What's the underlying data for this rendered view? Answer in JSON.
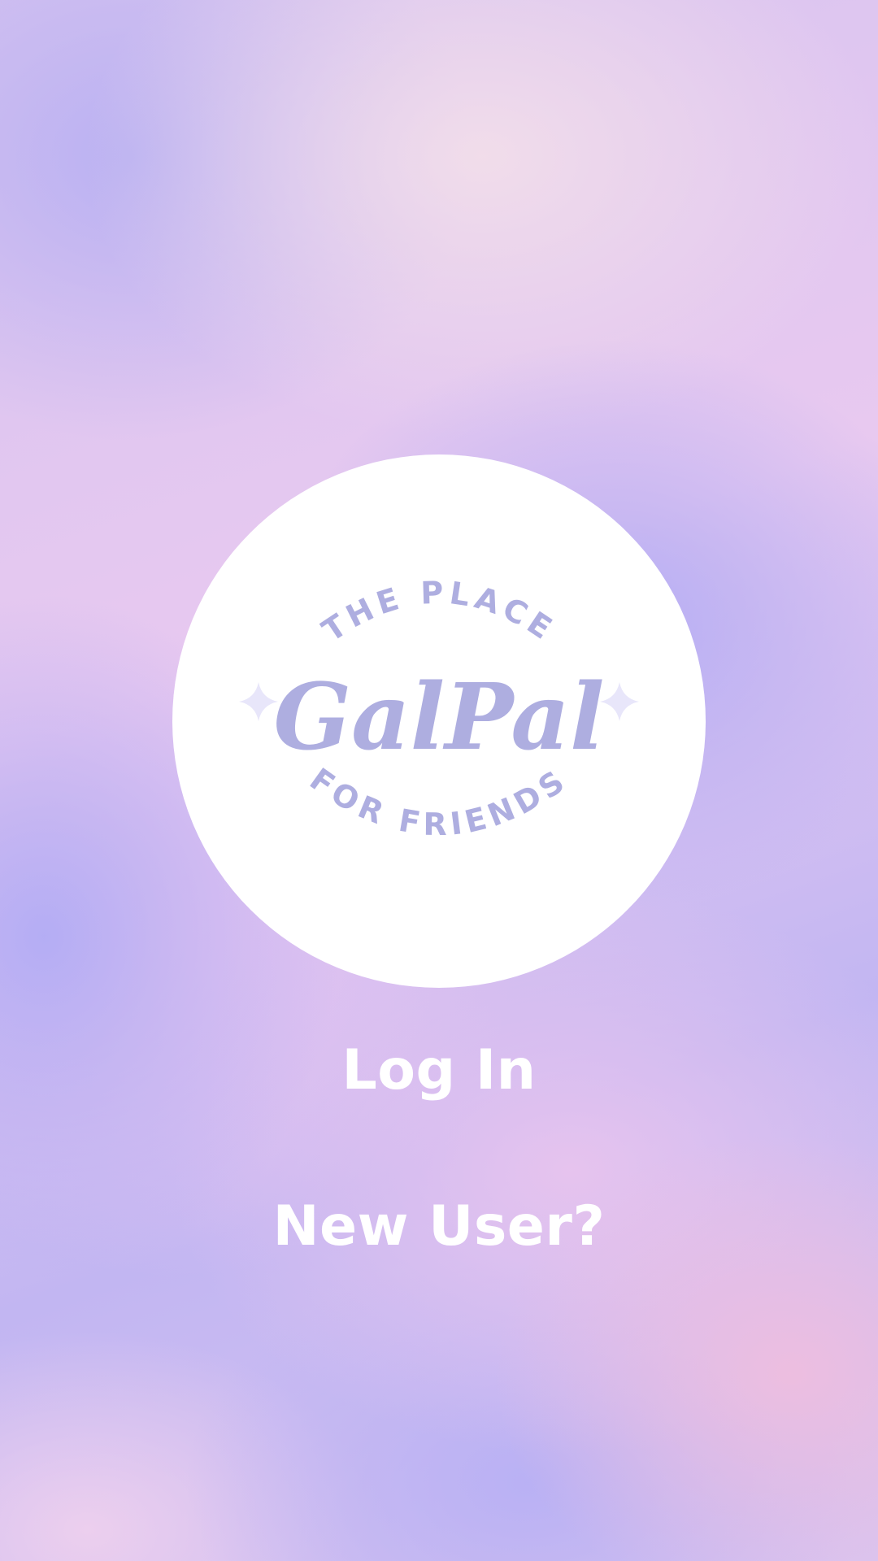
{
  "app": {
    "logo": {
      "top_text": "THE PLACE",
      "wordmark": "GalPal",
      "bottom_text": "FOR FRIENDS",
      "brand_color": "#aeaee0",
      "sparkle_color": "#e8e6fa",
      "icon_left": "sparkle-icon",
      "icon_right": "sparkle-icon"
    }
  },
  "actions": {
    "login_label": "Log In",
    "new_user_label": "New User?"
  },
  "colors": {
    "button_text": "#ffffff",
    "circle_background": "#ffffff"
  }
}
